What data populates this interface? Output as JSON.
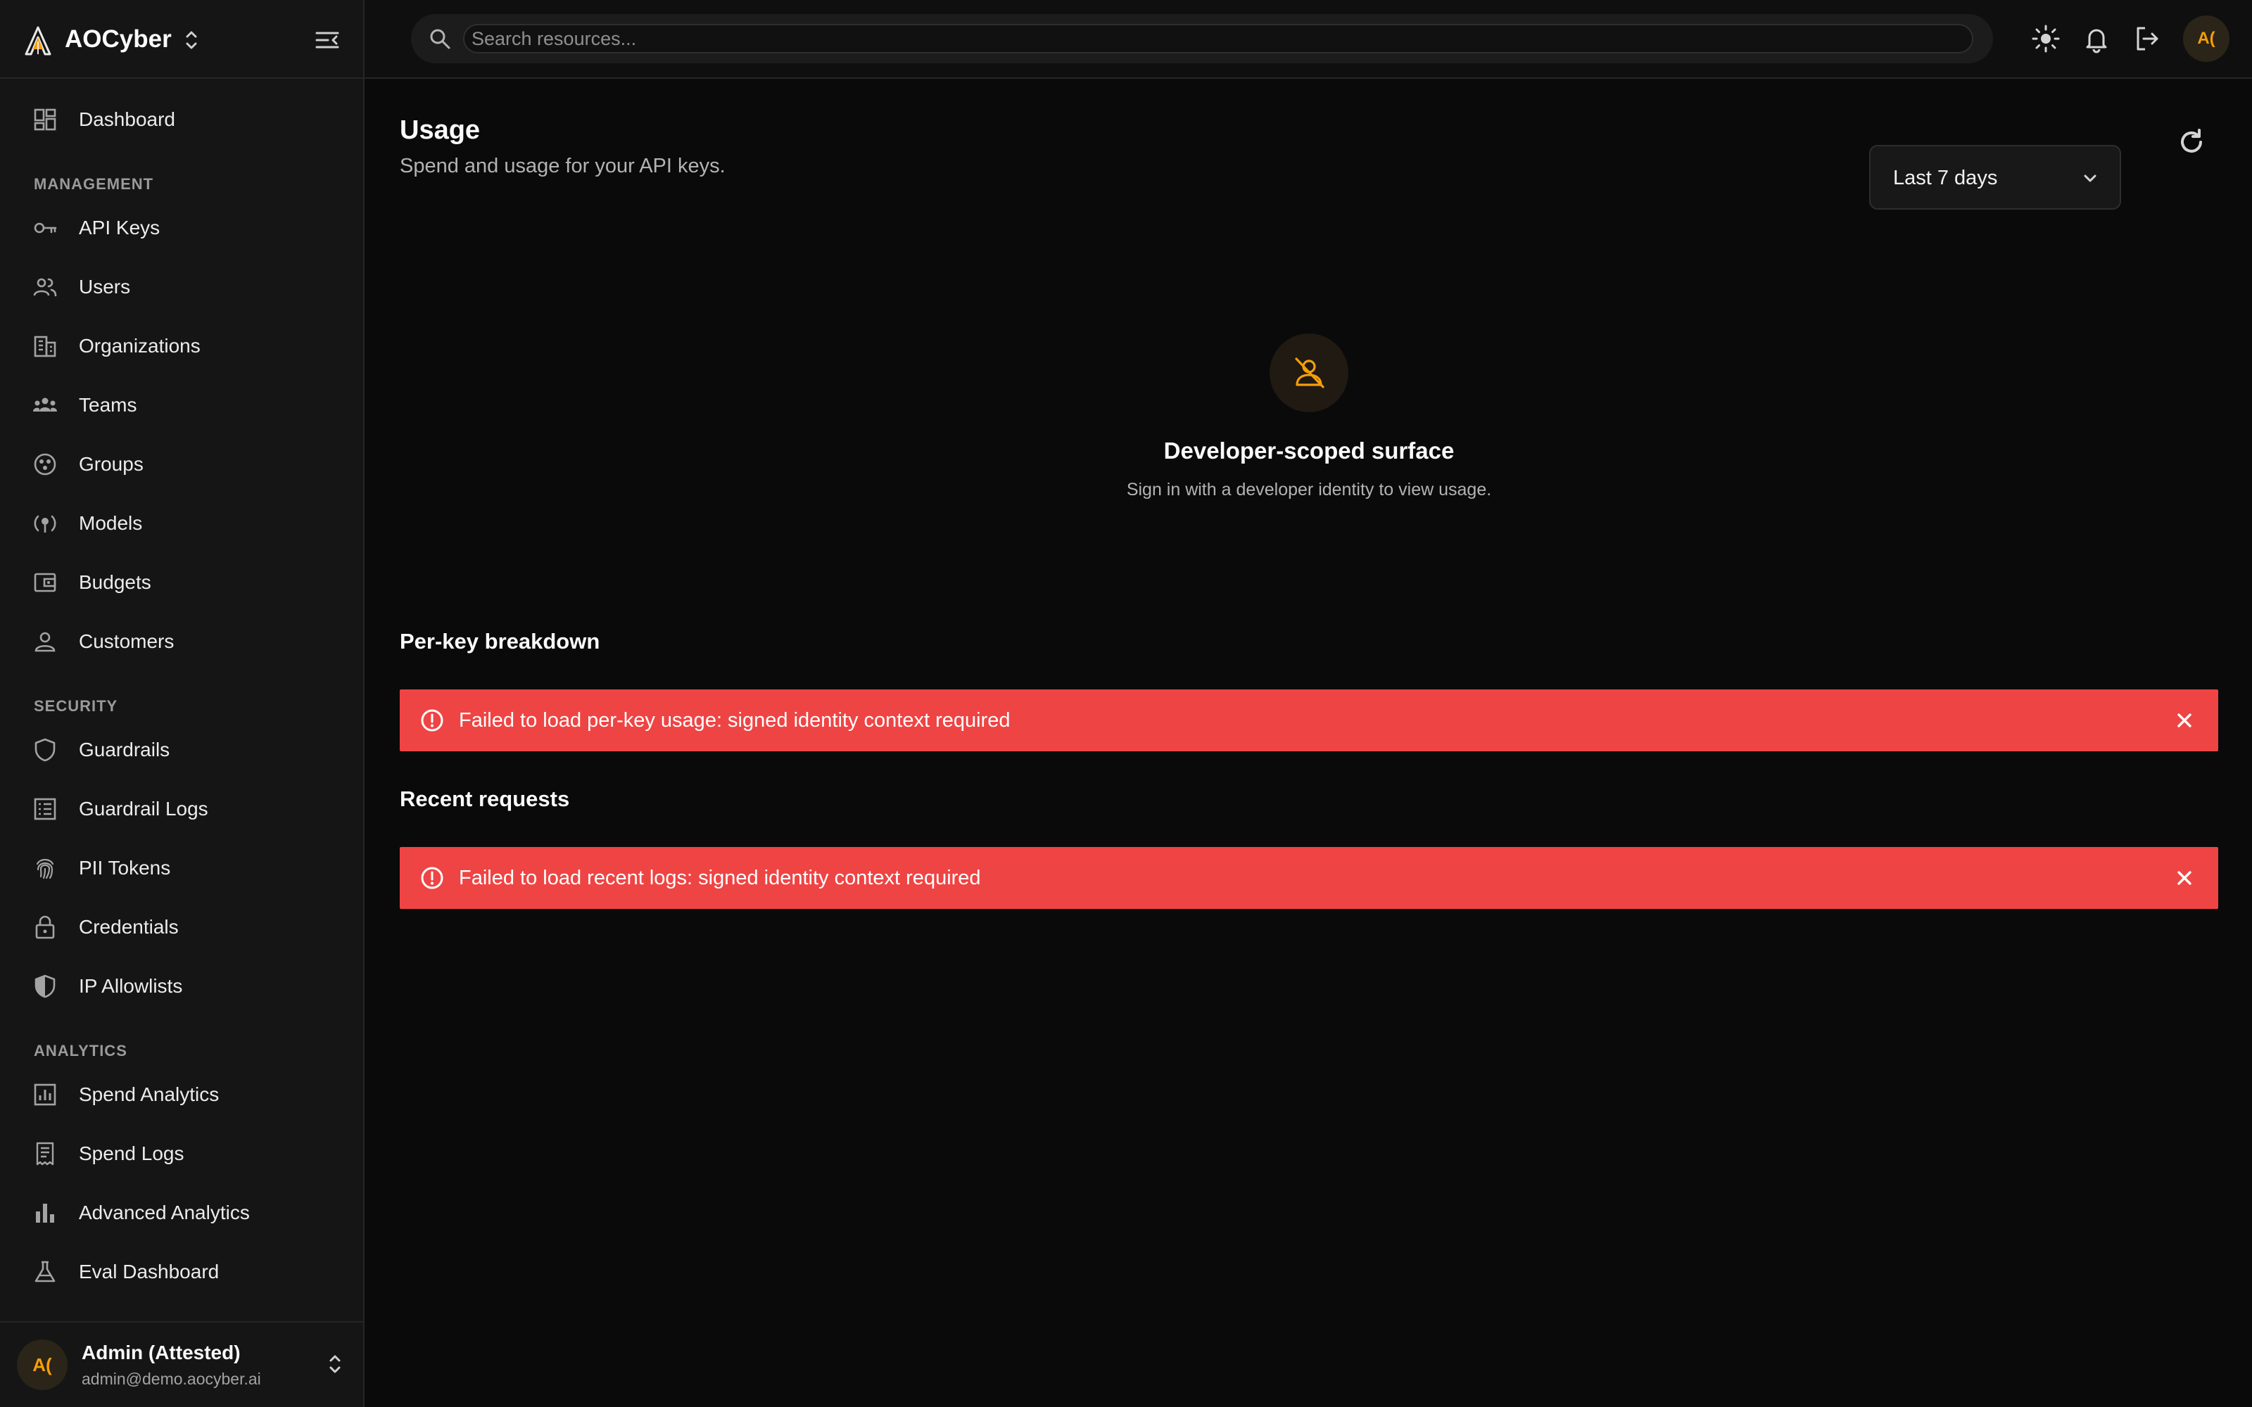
{
  "app": {
    "name": "AOCyber"
  },
  "sidebar": {
    "top_item": {
      "label": "Dashboard",
      "icon": "dashboard-icon"
    },
    "sections": [
      {
        "label": "MANAGEMENT",
        "items": [
          {
            "label": "API Keys",
            "icon": "key-icon"
          },
          {
            "label": "Users",
            "icon": "users-icon"
          },
          {
            "label": "Organizations",
            "icon": "building-icon"
          },
          {
            "label": "Teams",
            "icon": "team-icon"
          },
          {
            "label": "Groups",
            "icon": "groups-icon"
          },
          {
            "label": "Models",
            "icon": "models-icon"
          },
          {
            "label": "Budgets",
            "icon": "wallet-icon"
          },
          {
            "label": "Customers",
            "icon": "person-icon"
          }
        ]
      },
      {
        "label": "SECURITY",
        "items": [
          {
            "label": "Guardrails",
            "icon": "shield-icon"
          },
          {
            "label": "Guardrail Logs",
            "icon": "list-icon"
          },
          {
            "label": "PII Tokens",
            "icon": "fingerprint-icon"
          },
          {
            "label": "Credentials",
            "icon": "lock-icon"
          },
          {
            "label": "IP Allowlists",
            "icon": "shield-half-icon"
          }
        ]
      },
      {
        "label": "ANALYTICS",
        "items": [
          {
            "label": "Spend Analytics",
            "icon": "analytics-icon"
          },
          {
            "label": "Spend Logs",
            "icon": "receipt-icon"
          },
          {
            "label": "Advanced Analytics",
            "icon": "bar-chart-icon"
          },
          {
            "label": "Eval Dashboard",
            "icon": "flask-icon"
          }
        ]
      }
    ],
    "user": {
      "initials": "A(",
      "name": "Admin (Attested)",
      "email": "admin@demo.aocyber.ai"
    }
  },
  "topbar": {
    "search_placeholder": "Search resources...",
    "avatar_initials": "A("
  },
  "page": {
    "title": "Usage",
    "subtitle": "Spend and usage for your API keys.",
    "range_select": {
      "value": "Last 7 days"
    },
    "empty_state": {
      "title": "Developer-scoped surface",
      "text": "Sign in with a developer identity to view usage."
    },
    "per_key": {
      "title": "Per-key breakdown",
      "error": "Failed to load per-key usage: signed identity context required"
    },
    "recent": {
      "title": "Recent requests",
      "error": "Failed to load recent logs: signed identity context required"
    }
  },
  "colors": {
    "background": "#0a0a0a",
    "sidebar": "#151515",
    "accent": "#f59e0b",
    "error": "#ef4444"
  }
}
